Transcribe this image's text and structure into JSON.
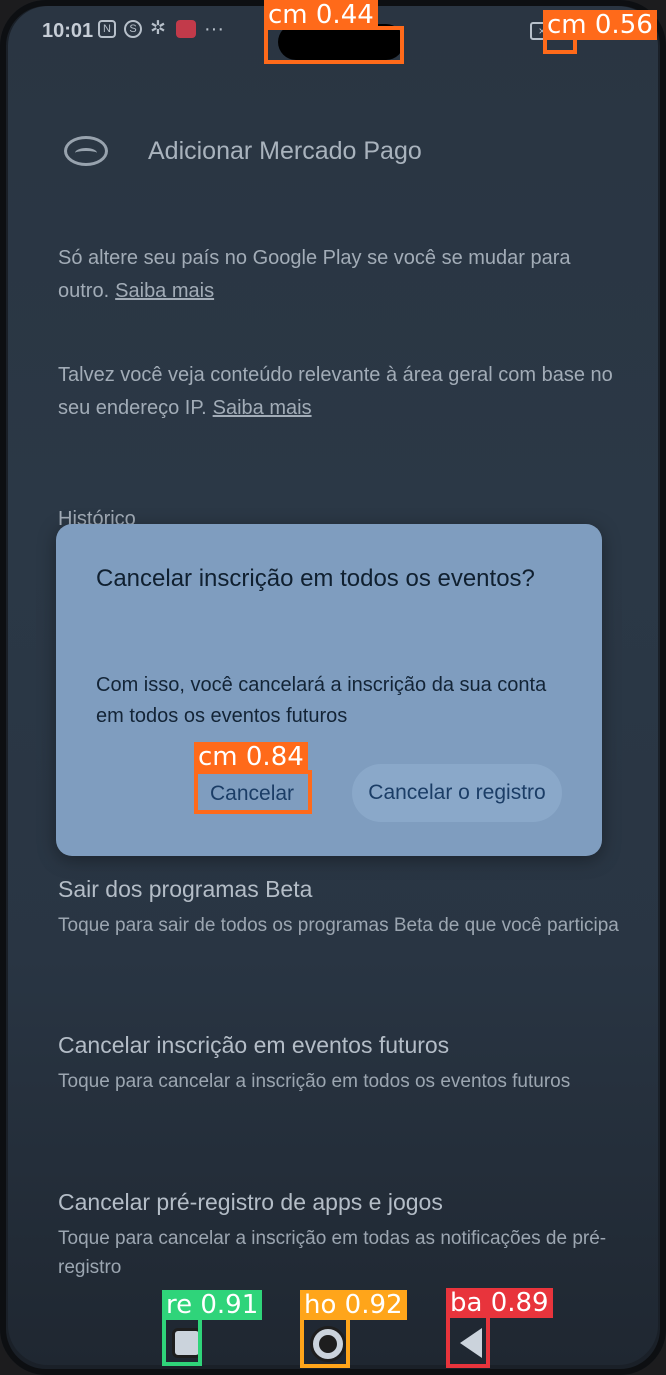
{
  "status_bar": {
    "time": "10:01",
    "left_icons": [
      "nfc-icon",
      "data-icon",
      "gear-icon",
      "app-notification-icon",
      "more-dots-icon"
    ],
    "right_icons": [
      "x-icon",
      "signal-icon",
      "battery-icon"
    ]
  },
  "background_screen": {
    "mercado_pago_label": "Adicionar Mercado Pago",
    "para1_text": "Só altere seu país no Google Play se você se mudar para outro.",
    "para1_link": "Saiba mais",
    "para2_text": "Talvez você veja conteúdo relevante à área geral com base no seu endereço IP.",
    "para2_link": "Saiba mais",
    "history_header": "Histórico",
    "items": [
      {
        "title": "Sair dos programas Beta",
        "subtitle": "Toque para sair de todos os programas Beta de que você participa"
      },
      {
        "title": "Cancelar inscrição em eventos futuros",
        "subtitle": "Toque para cancelar a inscrição em todos os eventos futuros"
      },
      {
        "title": "Cancelar pré-registro de apps e jogos",
        "subtitle": "Toque para cancelar a inscrição em todas as notificações de pré-registro"
      }
    ]
  },
  "dialog": {
    "title": "Cancelar inscrição em todos os eventos?",
    "message": "Com isso, você cancelará a inscrição da sua conta em todos os eventos futuros",
    "cancel_label": "Cancelar",
    "confirm_label": "Cancelar o registro"
  },
  "detections": {
    "notch": "cm 0.44",
    "status_icon": "cm 0.56",
    "cancel_button": "cm 0.84",
    "recent": "re 0.91",
    "home": "ho 0.92",
    "back": "ba 0.89"
  },
  "colors": {
    "cm": "#ff6a1a",
    "re": "#2fd47a",
    "ho": "#ffa51a",
    "ba": "#e8343c"
  }
}
